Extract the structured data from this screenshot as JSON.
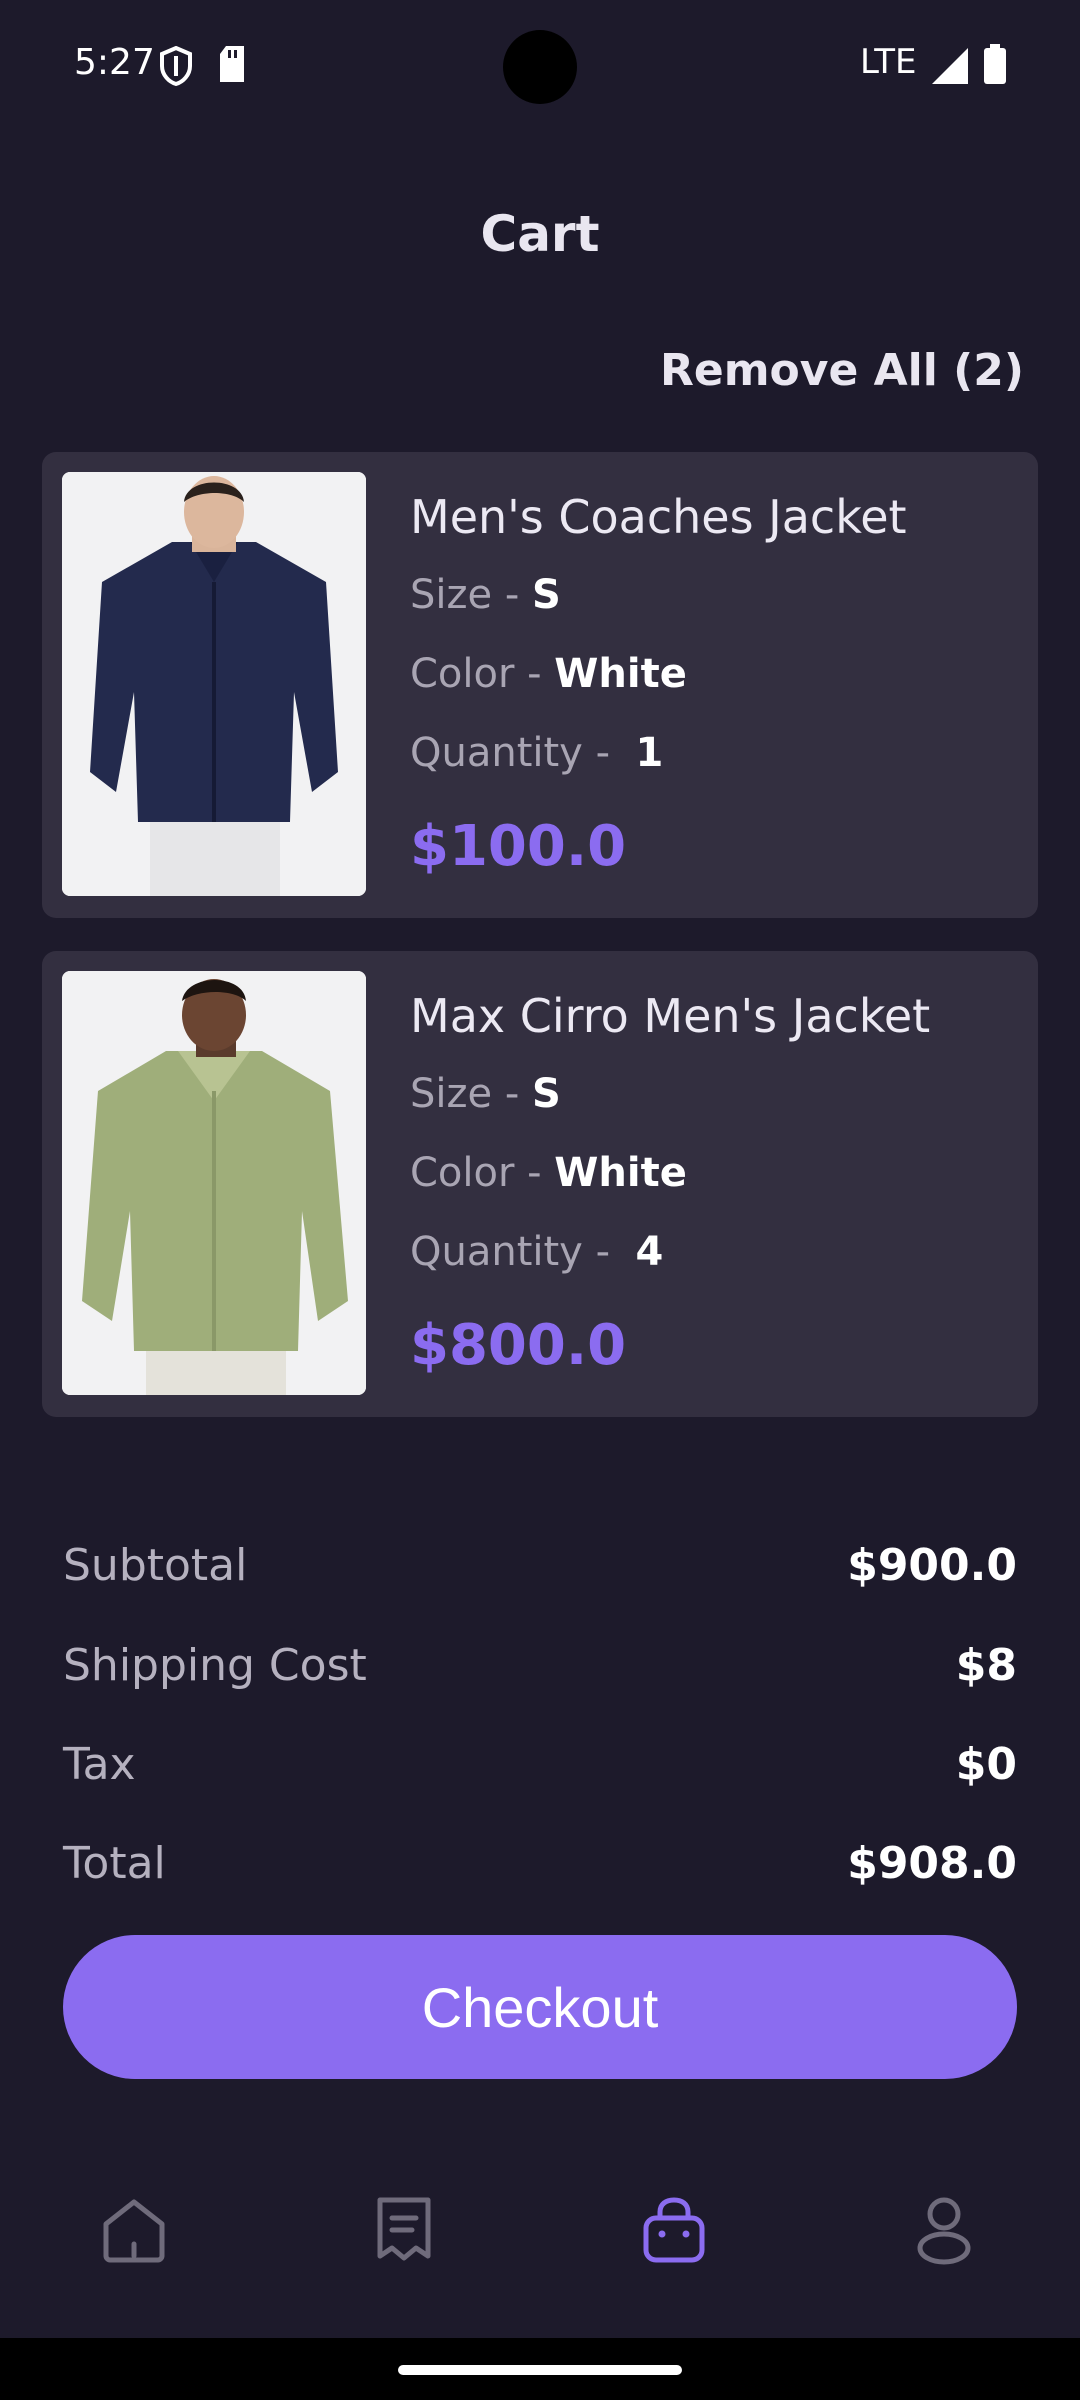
{
  "status": {
    "time": "5:27",
    "network": "LTE"
  },
  "header": {
    "title": "Cart",
    "remove_all": "Remove All (2)"
  },
  "labels": {
    "size": "Size - ",
    "color": "Color - ",
    "quantity": "Quantity - "
  },
  "items": [
    {
      "name": "Men's Coaches Jacket",
      "size": "S",
      "color": "White",
      "quantity": "1",
      "price": "$100.0"
    },
    {
      "name": "Max Cirro Men's Jacket",
      "size": "S",
      "color": "White",
      "quantity": "4",
      "price": "$800.0"
    }
  ],
  "summary": {
    "subtotal_label": "Subtotal",
    "subtotal": "$900.0",
    "shipping_label": "Shipping Cost",
    "shipping": "$8",
    "tax_label": "Tax",
    "tax": "$0",
    "total_label": "Total",
    "total": "$908.0"
  },
  "checkout_label": "Checkout",
  "nav": {
    "items": [
      "home-icon",
      "orders-icon",
      "cart-bag-icon",
      "profile-icon"
    ],
    "active": "cart-bag-icon"
  },
  "colors": {
    "background": "#1d1a2b",
    "card": "#332f40",
    "accent": "#8b6cf0"
  }
}
